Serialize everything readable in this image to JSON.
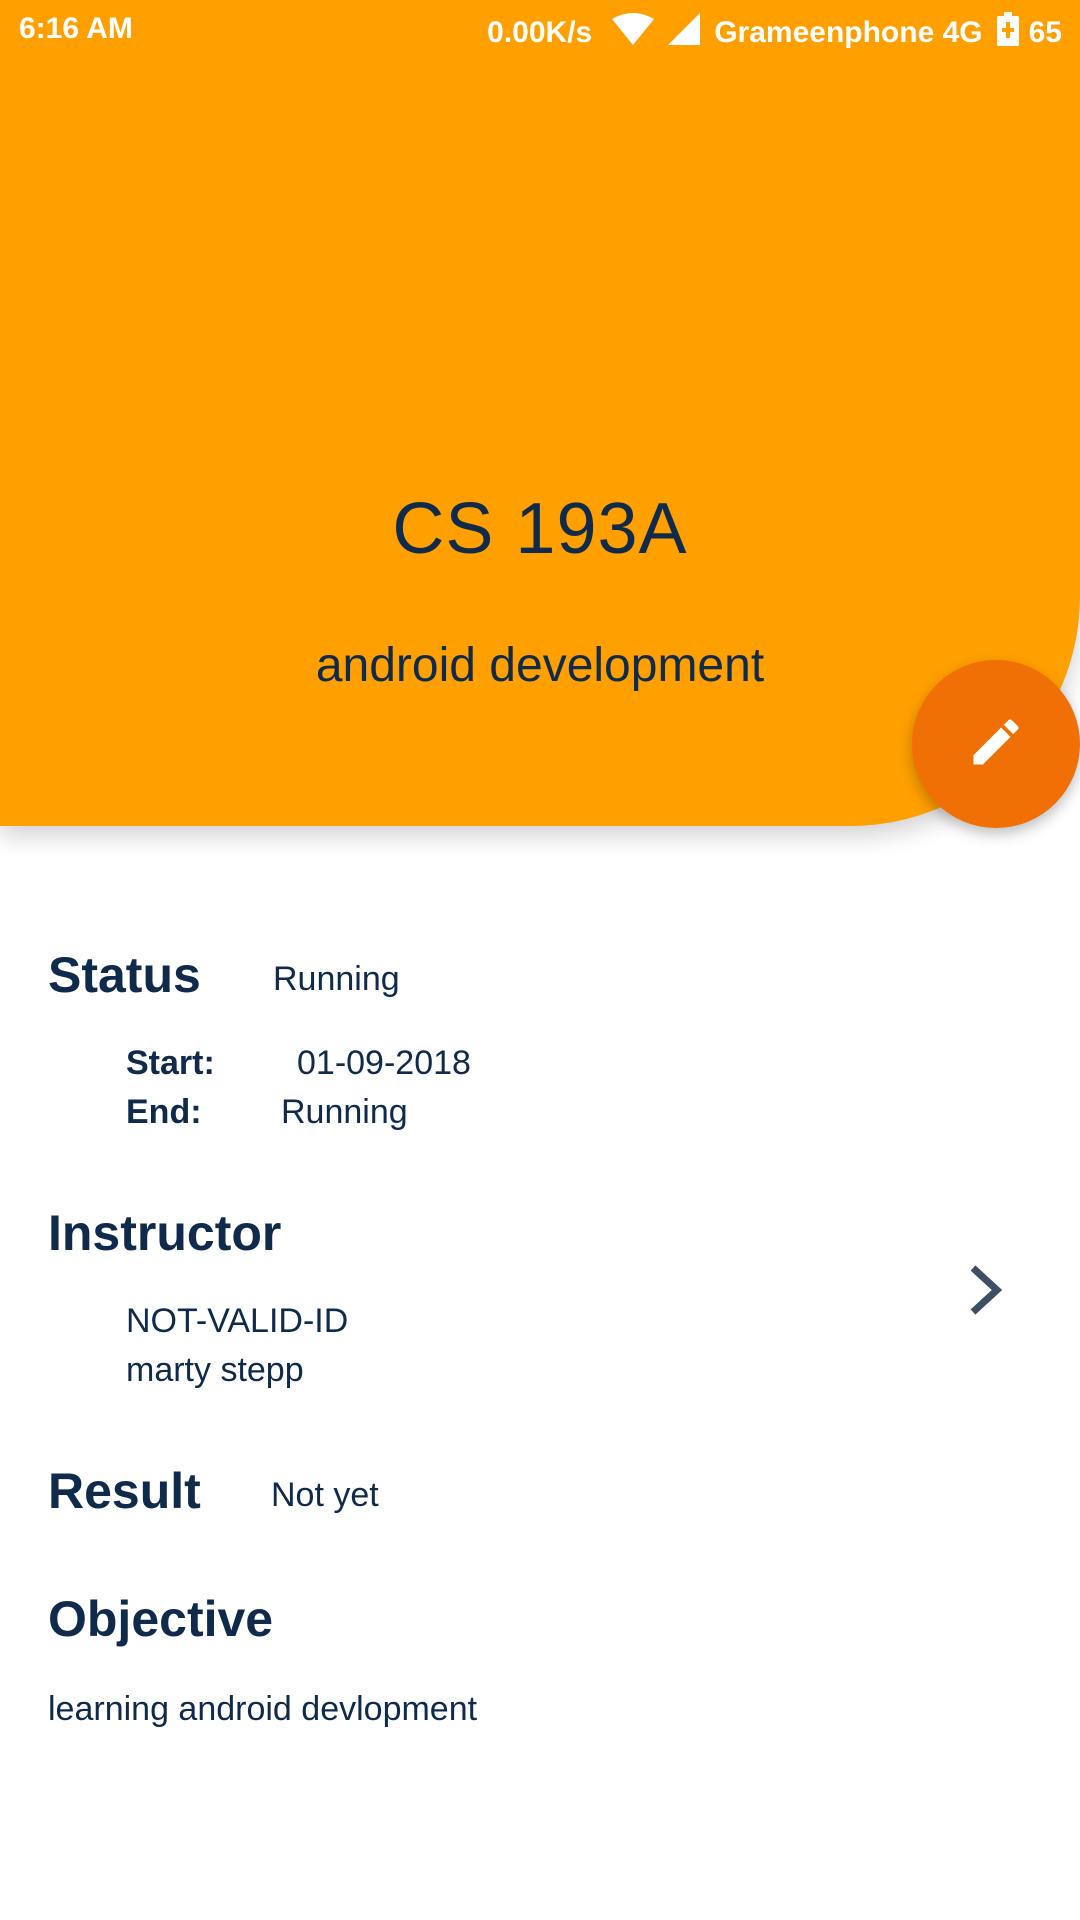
{
  "status_bar": {
    "time": "6:16 AM",
    "net_speed": "0.00K/s",
    "carrier": "Grameenphone 4G",
    "battery": "65",
    "icons": [
      "wifi-icon",
      "signal-icon",
      "battery-charging-icon"
    ]
  },
  "header": {
    "course_code": "CS 193A",
    "course_name": "android development",
    "background_color": "#FF9F00"
  },
  "fab": {
    "icon": "pencil-icon",
    "color": "#F07005"
  },
  "status_section": {
    "label": "Status",
    "value": "Running",
    "start_label": "Start:",
    "start_value": "01-09-2018",
    "end_label": "End:",
    "end_value": "Running"
  },
  "instructor_section": {
    "label": "Instructor",
    "id": "NOT-VALID-ID",
    "name": "marty stepp",
    "icon": "chevron-right-icon"
  },
  "result_section": {
    "label": "Result",
    "value": "Not yet"
  },
  "objective_section": {
    "label": "Objective",
    "value": "learning android devlopment"
  },
  "colors": {
    "text": "#0F2A4A",
    "accent": "#FF9F00"
  }
}
